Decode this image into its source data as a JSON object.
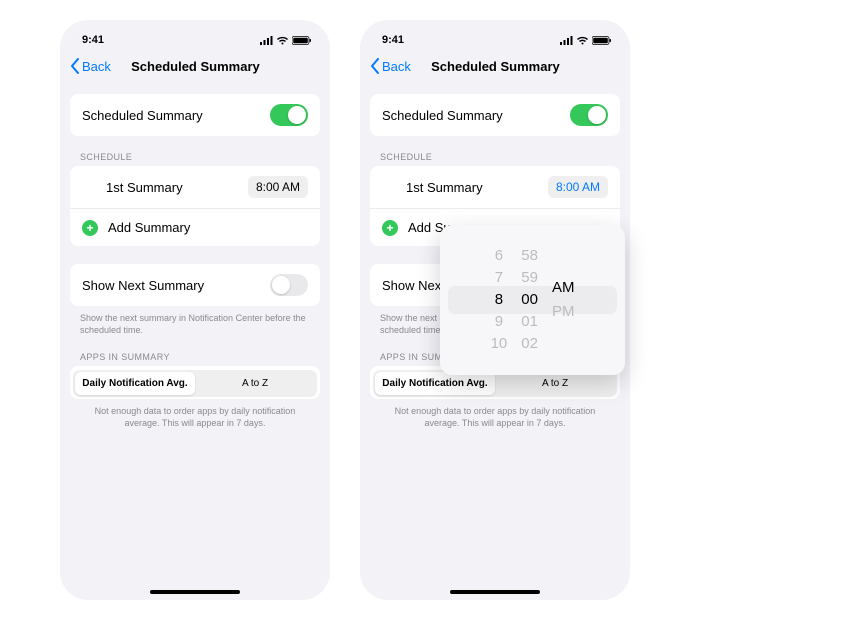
{
  "status": {
    "time": "9:41"
  },
  "nav": {
    "back": "Back",
    "title": "Scheduled Summary"
  },
  "summary_toggle": {
    "label": "Scheduled Summary"
  },
  "schedule": {
    "header": "SCHEDULE",
    "first_label": "1st Summary",
    "first_time": "8:00 AM",
    "add_label": "Add Summary"
  },
  "show_next": {
    "label": "Show Next Summary",
    "footer": "Show the next summary in Notification Center before the scheduled time."
  },
  "apps": {
    "header": "APPS IN SUMMARY",
    "seg_avg": "Daily Notification Avg.",
    "seg_az": "A to Z",
    "footer": "Not enough data to order apps by daily notification average. This will appear in 7 days."
  },
  "picker": {
    "hours": [
      "6",
      "7",
      "8",
      "9",
      "10"
    ],
    "minutes": [
      "58",
      "59",
      "00",
      "01",
      "02"
    ],
    "periods": [
      "AM",
      "PM"
    ],
    "selected_hour": "8",
    "selected_minute": "00",
    "selected_period": "AM"
  }
}
